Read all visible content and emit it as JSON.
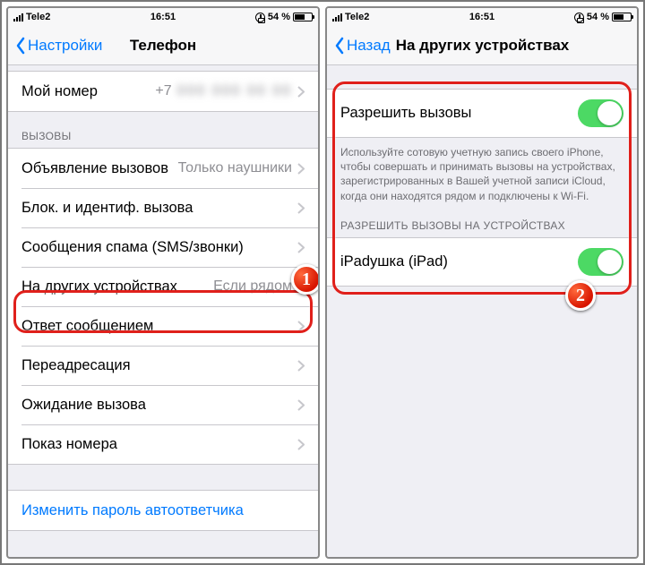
{
  "status": {
    "carrier": "Tele2",
    "time": "16:51",
    "battery_pct": "54 %"
  },
  "left": {
    "back_label": "Настройки",
    "title": "Телефон",
    "my_number_label": "Мой номер",
    "my_number_value": "+7",
    "section_calls": "ВЫЗОВЫ",
    "rows": {
      "announce": {
        "label": "Объявление вызовов",
        "value": "Только наушники"
      },
      "block": {
        "label": "Блок. и идентиф. вызова"
      },
      "spam": {
        "label": "Сообщения спама (SMS/звонки)"
      },
      "other_dev": {
        "label": "На других устройствах",
        "value": "Если рядом"
      },
      "reply": {
        "label": "Ответ сообщением"
      },
      "forward": {
        "label": "Переадресация"
      },
      "waiting": {
        "label": "Ожидание вызова"
      },
      "showid": {
        "label": "Показ номера"
      }
    },
    "change_vm_pass": "Изменить пароль автоответчика"
  },
  "right": {
    "back_label": "Назад",
    "title": "На других устройствах",
    "allow_calls_label": "Разрешить вызовы",
    "footer_text": "Используйте сотовую учетную запись своего iPhone, чтобы совершать и принимать вызовы на устройствах, зарегистрированных в Вашей учетной записи iCloud, когда они находятся рядом и подключены к Wi-Fi.",
    "devices_header": "РАЗРЕШИТЬ ВЫЗОВЫ НА УСТРОЙСТВАХ",
    "device1_label": "iPadушка (iPad)"
  },
  "badges": {
    "one": "1",
    "two": "2"
  }
}
